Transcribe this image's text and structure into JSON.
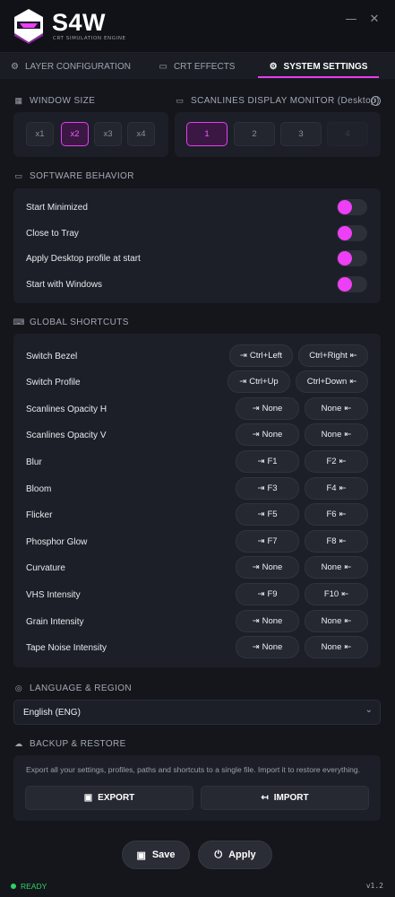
{
  "app": {
    "title": "S4W",
    "subtitle": "CRT SIMULATION ENGINE",
    "accent_color": "#e63df0",
    "minimize_icon": "minimize-icon",
    "close_icon": "close-icon"
  },
  "tabs": [
    {
      "label": "LAYER CONFIGURATION",
      "icon": "gear-icon",
      "active": false
    },
    {
      "label": "CRT EFFECTS",
      "icon": "monitor-icon",
      "active": false
    },
    {
      "label": "SYSTEM SETTINGS",
      "icon": "gear-icon",
      "active": true
    }
  ],
  "window_size": {
    "title": "WINDOW SIZE",
    "options": [
      "x1",
      "x2",
      "x3",
      "x4"
    ],
    "selected": "x2"
  },
  "scanlines_monitor": {
    "title": "SCANLINES DISPLAY MONITOR (Desktop)",
    "options": [
      "1",
      "2",
      "3",
      "4"
    ],
    "selected": "1",
    "disabled": "4"
  },
  "software_behavior": {
    "title": "SOFTWARE BEHAVIOR",
    "items": [
      {
        "label": "Start Minimized",
        "enabled": true
      },
      {
        "label": "Close to Tray",
        "enabled": true
      },
      {
        "label": "Apply Desktop profile at start",
        "enabled": true
      },
      {
        "label": "Start with Windows",
        "enabled": true
      }
    ]
  },
  "shortcuts": {
    "title": "GLOBAL SHORTCUTS",
    "items": [
      {
        "label": "Switch Bezel",
        "prev": "Ctrl+Left",
        "next": "Ctrl+Right"
      },
      {
        "label": "Switch Profile",
        "prev": "Ctrl+Up",
        "next": "Ctrl+Down"
      },
      {
        "label": "Scanlines Opacity H",
        "prev": "None",
        "next": "None"
      },
      {
        "label": "Scanlines Opacity V",
        "prev": "None",
        "next": "None"
      },
      {
        "label": "Blur",
        "prev": "F1",
        "next": "F2"
      },
      {
        "label": "Bloom",
        "prev": "F3",
        "next": "F4"
      },
      {
        "label": "Flicker",
        "prev": "F5",
        "next": "F6"
      },
      {
        "label": "Phosphor Glow",
        "prev": "F7",
        "next": "F8"
      },
      {
        "label": "Curvature",
        "prev": "None",
        "next": "None"
      },
      {
        "label": "VHS Intensity",
        "prev": "F9",
        "next": "F10"
      },
      {
        "label": "Grain Intensity",
        "prev": "None",
        "next": "None"
      },
      {
        "label": "Tape Noise Intensity",
        "prev": "None",
        "next": "None"
      }
    ]
  },
  "language": {
    "title": "LANGUAGE & REGION",
    "selected": "English (ENG)"
  },
  "backup": {
    "title": "BACKUP & RESTORE",
    "description": "Export all your settings, profiles, paths and shortcuts to a single file. Import it to restore everything.",
    "export_label": "EXPORT",
    "import_label": "IMPORT"
  },
  "footer": {
    "save_label": "Save",
    "apply_label": "Apply",
    "status": "READY",
    "status_color": "#2ed165",
    "version": "v1.2"
  }
}
